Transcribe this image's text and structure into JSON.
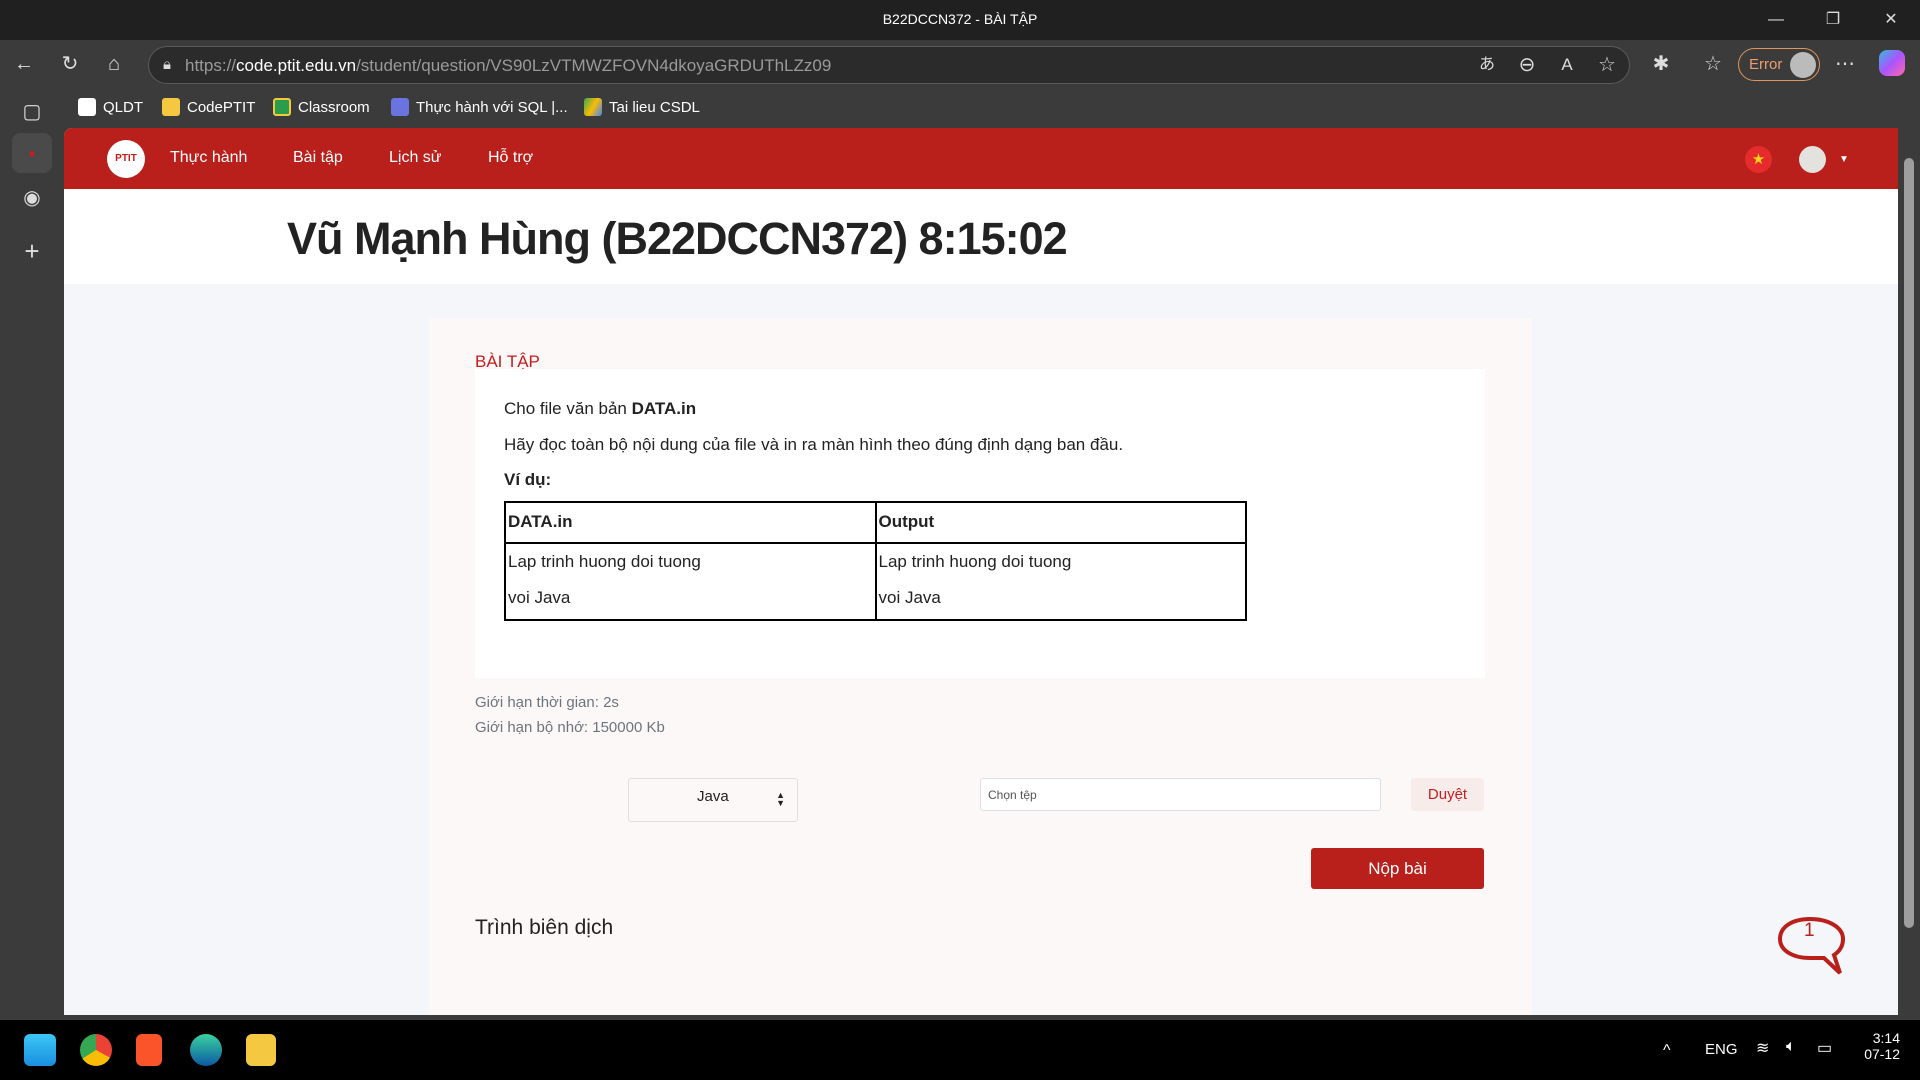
{
  "window": {
    "title": "B22DCCN372 - BÀI TẬP"
  },
  "browser": {
    "url_scheme": "https://",
    "url_host": "code.ptit.edu.vn",
    "url_path": "/student/question/VS90LzVTMWZFOVN4dkoyaGRDUThLZz09",
    "profile_label": "Error",
    "bookmarks": [
      {
        "label": "QLDT"
      },
      {
        "label": "CodePTIT"
      },
      {
        "label": "Classroom"
      },
      {
        "label": "Thực hành với SQL |..."
      },
      {
        "label": "Tai lieu CSDL"
      }
    ]
  },
  "site": {
    "logo_text": "PTIT",
    "nav": [
      {
        "label": "Thực hành"
      },
      {
        "label": "Bài tập"
      },
      {
        "label": "Lịch sử"
      },
      {
        "label": "Hỗ trợ"
      }
    ],
    "header_title": "Vũ Mạnh Hùng (B22DCCN372) 8:15:02"
  },
  "problem": {
    "section_label": "BÀI TẬP",
    "line1_prefix": "Cho file văn bản ",
    "line1_bold": "DATA.in",
    "line2": "Hãy đọc toàn bộ nội dung của file và in ra màn hình theo đúng định dạng ban đầu.",
    "example_label": "Ví dụ:",
    "table": {
      "headers": [
        "DATA.in",
        "Output"
      ],
      "rows": [
        [
          "Lap trinh huong doi tuong",
          "voi Java"
        ],
        [
          "Lap trinh huong doi tuong",
          "voi Java"
        ]
      ]
    },
    "time_limit": "Giới hạn thời gian: 2s",
    "memory_limit": "Giới hạn bộ nhớ: 150000 Kb"
  },
  "submit_form": {
    "compiler_label": "Trình biên dịch",
    "compiler_value": "Java",
    "file_placeholder": "Chọn tệp",
    "browse_label": "Duyệt",
    "submit_label": "Nộp bài"
  },
  "chat": {
    "badge": "1"
  },
  "taskbar": {
    "lang": "ENG",
    "time": "3:14",
    "date": "07-12"
  },
  "colors": {
    "brand": "#b91f1b",
    "card_bg": "#fcf8f7"
  }
}
